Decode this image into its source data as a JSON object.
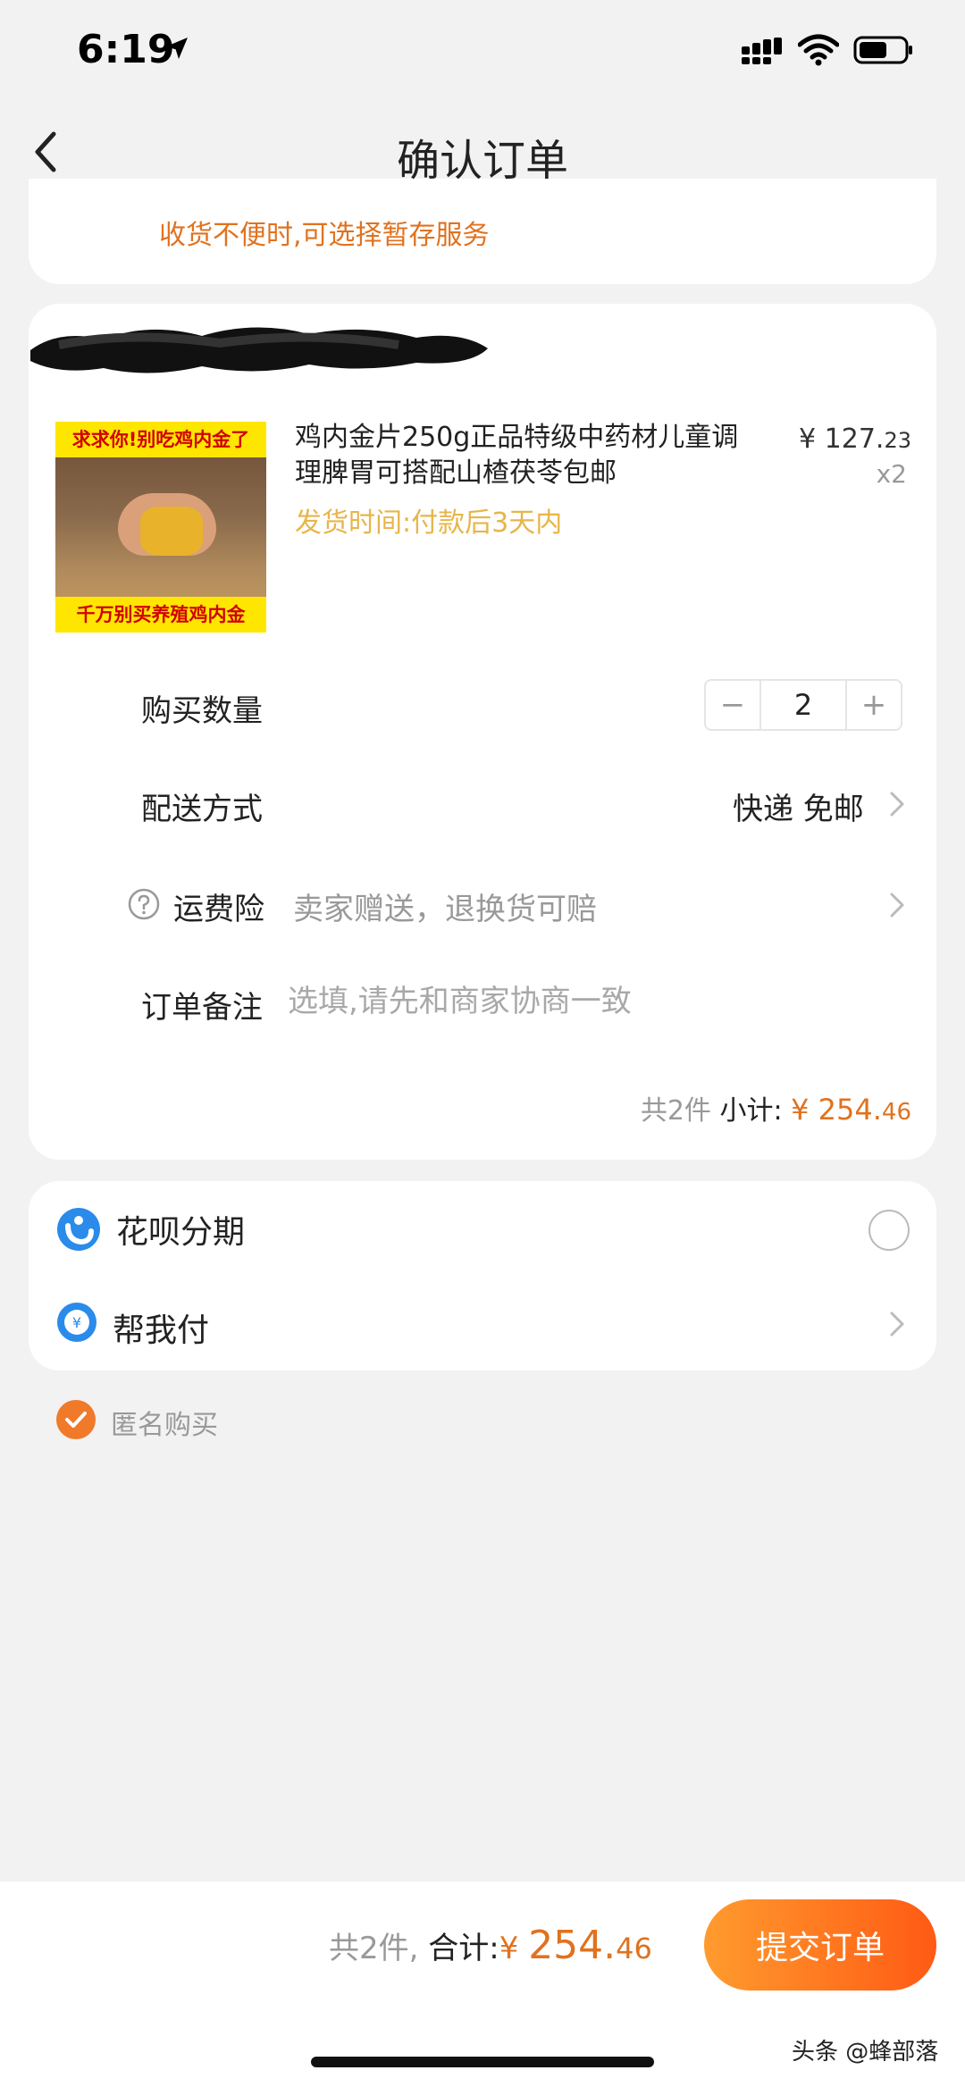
{
  "status_bar": {
    "time": "6:19",
    "icons": [
      "location-arrow-icon",
      "signal-icon",
      "wifi-icon",
      "battery-icon"
    ]
  },
  "nav": {
    "back_icon": "chevron-left-icon",
    "title": "确认订单"
  },
  "storage_notice": "收货不便时,可选择暂存服务",
  "product": {
    "image_banner_top": "求求你!别吃鸡内金了",
    "image_banner_bottom": "千万别买养殖鸡内金",
    "title": "鸡内金片250g正品特级中药材儿童调理脾胃可搭配山楂茯苓包邮",
    "ship_time": "发货时间:付款后3天内",
    "price_currency": "¥",
    "price_int": "127.",
    "price_dec": "23",
    "qty_label": "x2"
  },
  "rows": {
    "quantity_label": "购买数量",
    "quantity_value": "2",
    "minus": "−",
    "plus": "+",
    "delivery_label": "配送方式",
    "delivery_value": "快递 免邮",
    "insurance_label": "运费险",
    "insurance_value": "卖家赠送，退换货可赔",
    "note_label": "订单备注",
    "note_placeholder": "选填,请先和商家协商一致"
  },
  "subtotal": {
    "count": "共2件",
    "label": "小计:",
    "currency": "¥",
    "int": "254.",
    "dec": "46"
  },
  "payment": {
    "huabei_label": "花呗分期",
    "helppay_label": "帮我付"
  },
  "anonymous_label": "匿名购买",
  "bottom": {
    "count": "共2件,",
    "label": "合计:",
    "currency": "¥",
    "int": "254.",
    "dec": "46",
    "submit": "提交订单"
  },
  "watermark": "头条 @蜂部落",
  "colors": {
    "accent": "#e0721f",
    "ship_time": "#e7b54a",
    "button_from": "#ff9b2e",
    "button_to": "#ff5a14",
    "background": "#f2f2f2"
  }
}
